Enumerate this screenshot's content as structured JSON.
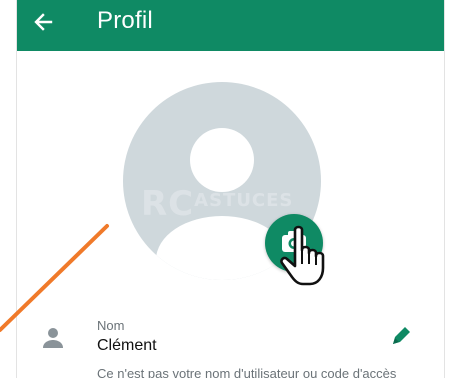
{
  "appbar": {
    "title": "Profil",
    "back_icon": "arrow-left-icon",
    "color": "#0f8a64"
  },
  "avatar": {
    "icon": "default-avatar-icon",
    "background": "#cfd8dc",
    "camera_button_icon": "camera-icon"
  },
  "watermark": {
    "main": "RC",
    "small": "ASTUCES"
  },
  "profile": {
    "name_label": "Nom",
    "name_value": "Clément",
    "helper_text": "Ce n'est pas votre nom d'utilisateur ou code d'accès",
    "person_icon": "person-icon",
    "edit_icon": "pencil-icon"
  },
  "annotation": {
    "line_color": "#f07a2a",
    "pointer": "hand-pointer-icon"
  }
}
